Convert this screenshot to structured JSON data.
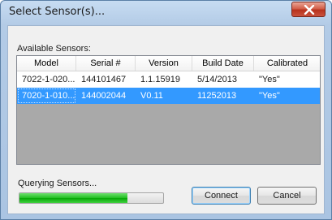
{
  "window": {
    "title": "Select Sensor(s)..."
  },
  "group_label": "Available Sensors:",
  "table": {
    "columns": [
      "Model",
      "Serial #",
      "Version",
      "Build Date",
      "Calibrated"
    ],
    "rows": [
      {
        "model": "7022-1-020...",
        "serial": "144101467",
        "version": "1.1.15919",
        "build_date": "5/14/2013",
        "calibrated": "\"Yes\"",
        "selected": false
      },
      {
        "model": "7020-1-010...",
        "serial": "144002044",
        "version": "V0.11",
        "build_date": "11252013",
        "calibrated": "\"Yes\"",
        "selected": true
      }
    ]
  },
  "status": {
    "text": "Querying Sensors...",
    "progress": 0.75
  },
  "buttons": {
    "connect": "Connect",
    "cancel": "Cancel"
  },
  "icons": {
    "close": "close-icon"
  },
  "colors": {
    "selection": "#3399ff",
    "progress": "#06b025",
    "close": "#c9523d"
  }
}
